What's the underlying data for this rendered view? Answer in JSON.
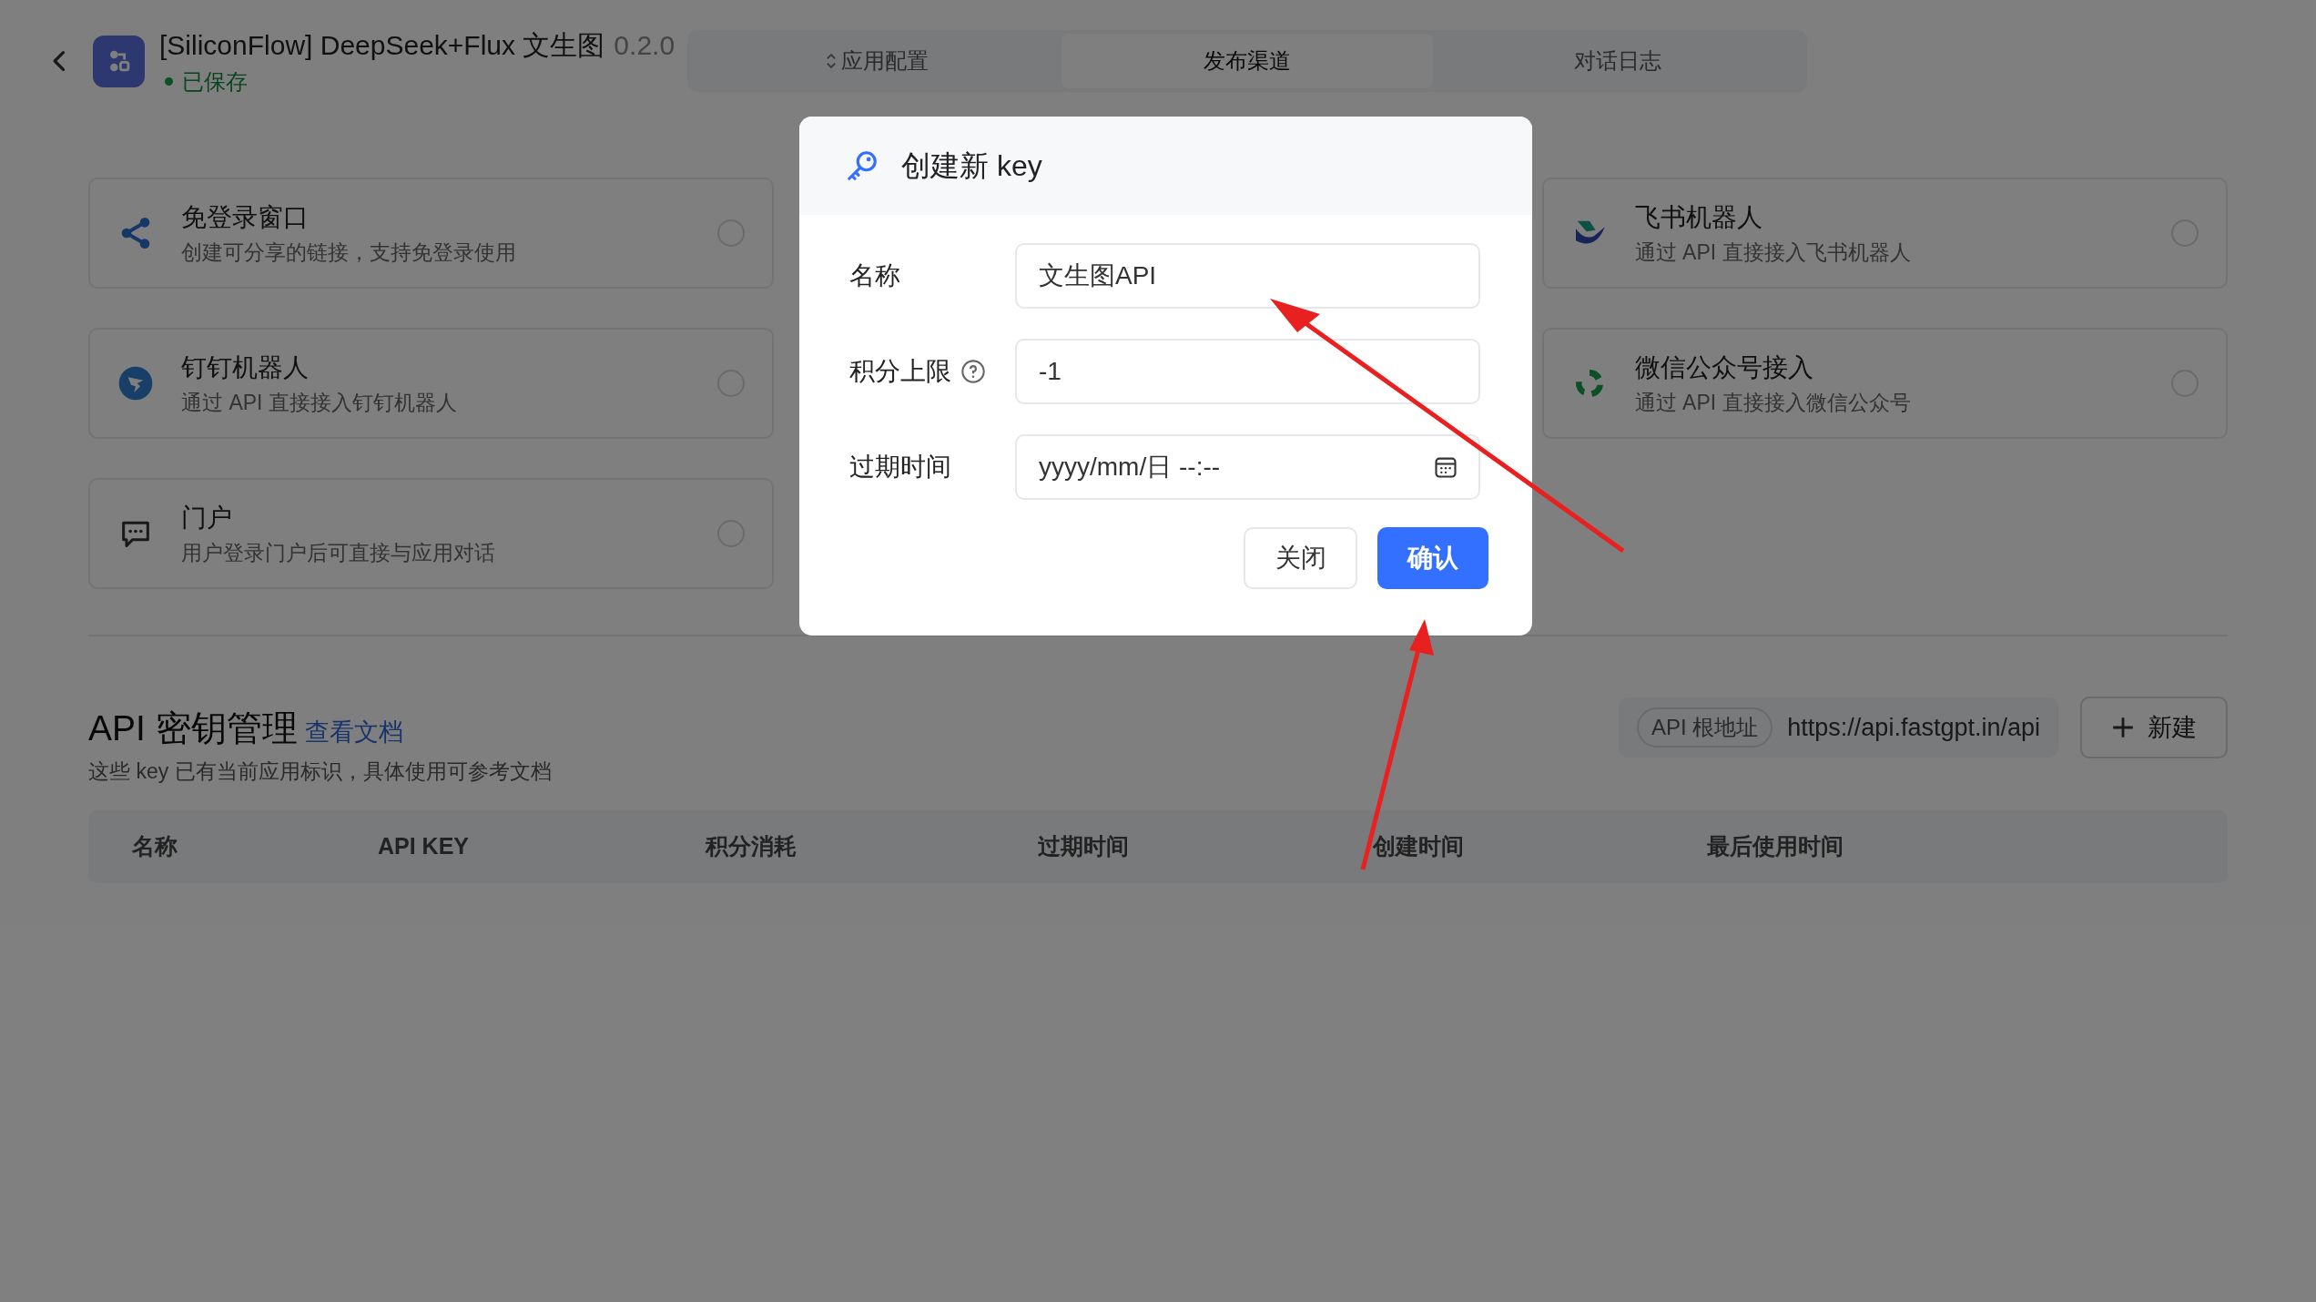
{
  "header": {
    "app_title": "[SiliconFlow] DeepSeek+Flux 文生图",
    "version": "0.2.0",
    "save_status": "已保存"
  },
  "tabs": [
    {
      "label": "应用配置",
      "selected": false
    },
    {
      "label": "发布渠道",
      "selected": true
    },
    {
      "label": "对话日志",
      "selected": false
    }
  ],
  "channel_columns": [
    [
      {
        "kind": "share",
        "title": "免登录窗口",
        "description": "创建可分享的链接，支持免登录使用",
        "selected": false
      },
      {
        "kind": "dingtalk",
        "title": "钉钉机器人",
        "description": "通过 API 直接接入钉钉机器人",
        "selected": false
      },
      {
        "kind": "chat",
        "title": "门户",
        "description": "用户登录门户后可直接与应用对话",
        "selected": false
      }
    ],
    [
      {
        "kind": "feishu",
        "title": "飞书机器人",
        "description": "通过 API 直接接入飞书机器人",
        "selected": false
      },
      {
        "kind": "wechat",
        "title": "微信公众号接入",
        "description": "通过 API 直接接入微信公众号",
        "selected": false
      }
    ]
  ],
  "api_keys": {
    "title": "API 密钥管理",
    "doc_link": "查看文档",
    "subtitle": "这些 key 已有当前应用标识，具体使用可参考文档",
    "base_url_label": "API 根地址",
    "base_url": "https://api.fastgpt.in/api",
    "new_button": "新建",
    "columns": [
      "名称",
      "API KEY",
      "积分消耗",
      "过期时间",
      "创建时间",
      "最后使用时间"
    ]
  },
  "dialog": {
    "title": "创建新 key",
    "fields": [
      {
        "label": "名称",
        "kind": "text",
        "value": "文生图API",
        "help": false
      },
      {
        "label": "积分上限",
        "kind": "number",
        "value": "-1",
        "help": true
      },
      {
        "label": "过期时间",
        "kind": "datetime",
        "placeholder": "yyyy/mm/日 --:--",
        "help": false
      }
    ],
    "buttons": [
      {
        "label": "关闭",
        "kind": "secondary"
      },
      {
        "label": "确认",
        "kind": "primary"
      }
    ]
  }
}
